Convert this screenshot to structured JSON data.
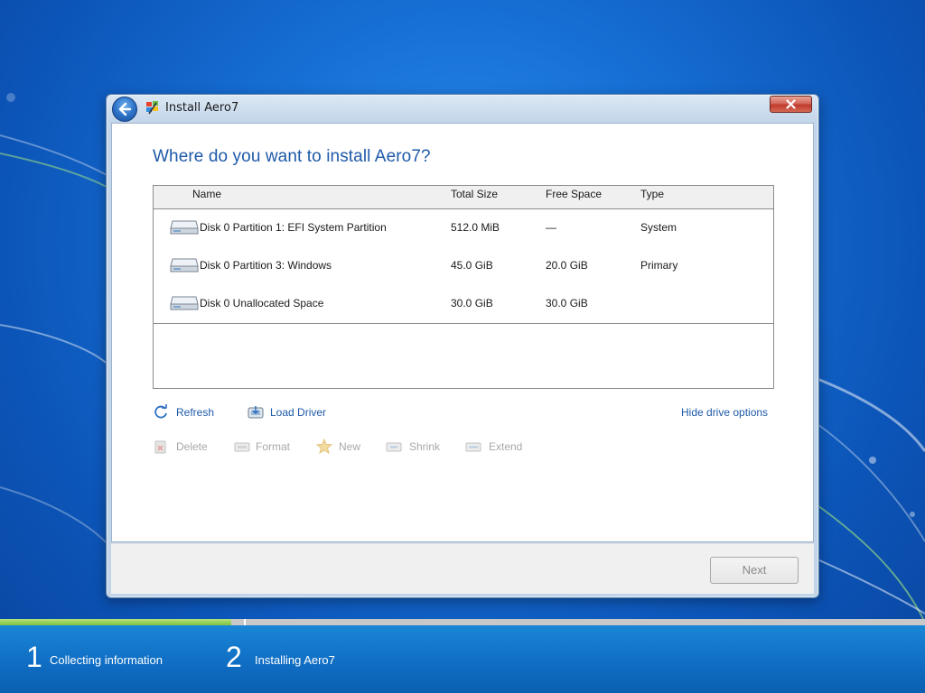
{
  "window": {
    "title": "Install Aero7"
  },
  "page": {
    "heading": "Where do you want to install Aero7?"
  },
  "table": {
    "columns": {
      "name": "Name",
      "total_size": "Total Size",
      "free_space": "Free Space",
      "type": "Type"
    },
    "rows": [
      {
        "name": "Disk 0 Partition 1: EFI System Partition",
        "total_size": "512.0 MiB",
        "free_space": "—",
        "type": "System"
      },
      {
        "name": "Disk 0 Partition 3: Windows",
        "total_size": "45.0 GiB",
        "free_space": "20.0 GiB",
        "type": "Primary"
      },
      {
        "name": "Disk 0 Unallocated Space",
        "total_size": "30.0 GiB",
        "free_space": "30.0 GiB",
        "type": ""
      }
    ]
  },
  "actions": {
    "refresh": "Refresh",
    "load_driver": "Load Driver",
    "hide_drive_options": "Hide drive options",
    "delete": "Delete",
    "format": "Format",
    "new": "New",
    "shrink": "Shrink",
    "extend": "Extend"
  },
  "footer": {
    "next_label": "Next"
  },
  "progress": {
    "fraction": 0.25,
    "steps": [
      {
        "number": "1",
        "label": "Collecting information"
      },
      {
        "number": "2",
        "label": "Installing Aero7"
      }
    ]
  },
  "colors": {
    "accent": "#1e5aa8",
    "progress_fill": "#7cc241",
    "bottom_bar": "#0f6cc2"
  }
}
